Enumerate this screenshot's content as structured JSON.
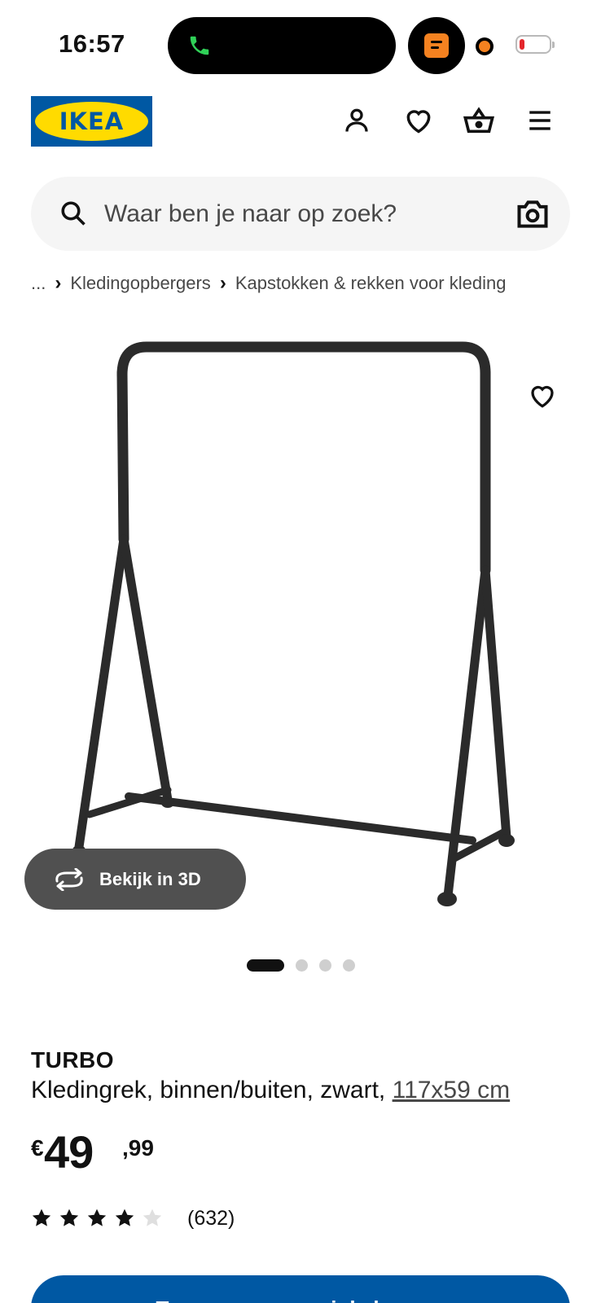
{
  "status_bar": {
    "time": "16:57"
  },
  "header": {
    "logo_text": "IKEA",
    "icons": [
      "user-icon",
      "heart-icon",
      "basket-icon",
      "hamburger-menu-icon"
    ]
  },
  "search": {
    "placeholder": "Waar ben je naar op zoek?",
    "value": ""
  },
  "breadcrumb": {
    "ellipsis": "...",
    "items": [
      "Kledingopbergers",
      "Kapstokken & rekken voor kleding"
    ]
  },
  "gallery": {
    "view_3d_label": "Bekijk in 3D",
    "image_count": 4,
    "active_index": 0
  },
  "product": {
    "name": "TURBO",
    "description": "Kledingrek, binnen/buiten, zwart,",
    "dimensions": "117x59 cm",
    "price_currency": "€",
    "price_integer": "49",
    "price_decimal": ",99",
    "rating": 4,
    "rating_max": 5,
    "review_count": "(632)"
  },
  "cta": {
    "label": "Toevoegen aan winkelwagen"
  },
  "colors": {
    "brand_blue": "#0058a3",
    "brand_yellow": "#ffdb00",
    "status_orange": "#f58220",
    "call_green": "#30d158"
  }
}
